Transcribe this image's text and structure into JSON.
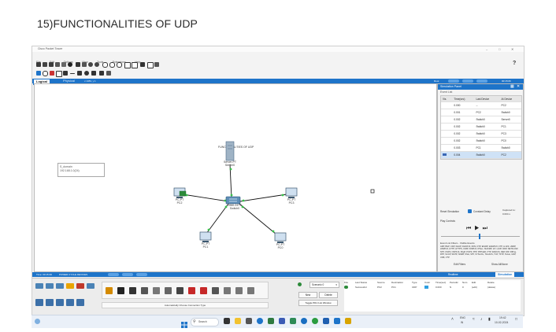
{
  "doc_title": "15)FUNCTIONALITIES  OF UDP",
  "app_title": "Cisco Packet Tracer",
  "menu": [
    "File",
    "Edit",
    "Options",
    "View",
    "Tools",
    "Extensions",
    "Help"
  ],
  "mode_bar": {
    "logical_tab": "Logical",
    "physical_tab": "Physical",
    "coords": "x:1089, y:1",
    "right_items": [
      "Root",
      "",
      "",
      "",
      "",
      "00:15:06"
    ]
  },
  "workspace": {
    "label": "FUNCTIONALITIES OF UDP",
    "note_lines": [
      "S_domain",
      "192.168.1.0(24)"
    ],
    "devices": [
      {
        "id": "server",
        "label1": "Server-PT",
        "label2": "Server0"
      },
      {
        "id": "switch",
        "label1": "2960-24TT",
        "label2": "Switch0"
      },
      {
        "id": "pc2",
        "label1": "PC-PT",
        "label2": "PC2"
      },
      {
        "id": "pc3",
        "label1": "PC-PT",
        "label2": "PC3"
      },
      {
        "id": "pc1",
        "label1": "PC-PT",
        "label2": "PC1"
      },
      {
        "id": "pc0",
        "label1": "PC-PT",
        "label2": "PC0"
      }
    ]
  },
  "sim_panel": {
    "title": "Simulation Panel",
    "subtitle": "Event List",
    "columns": [
      "Vis.",
      "Time(sec)",
      "Last Device",
      "At Device"
    ],
    "rows": [
      [
        "",
        "0.000",
        "--",
        "PC2"
      ],
      [
        "",
        "0.001",
        "PC2",
        "Switch0"
      ],
      [
        "",
        "0.002",
        "Switch0",
        "Server0"
      ],
      [
        "",
        "0.002",
        "Switch0",
        "PC1"
      ],
      [
        "",
        "0.002",
        "Switch0",
        "PC3"
      ],
      [
        "",
        "0.002",
        "Switch0",
        "PC0"
      ],
      [
        "",
        "0.003",
        "PC1",
        "Switch0"
      ],
      [
        "",
        "0.004",
        "Switch0",
        "PC2"
      ]
    ],
    "reset_label": "Reset Simulation",
    "constant_delay_label": "Constant Delay",
    "captured_label": "Captured to:",
    "captured_value": "0.004 s",
    "play_controls_label": "Play Controls",
    "event_filters_label": "Event List Filters - Visible Events",
    "event_filters_value": "ARP, BGP, CDP, DHCP, DHCPv6, DNS, DTP, EIGRP, EIGRPv6, FTP, H.323, HSRP, HSRPv6, HTTP, HTTPS, ICMP, ICMPv6, IPSec, ISAKMP, IoT, LLDP, NDP, NETFLOW, NTP, OSPF, OSPFv6, PAgP, POP3, PPP, PPPoED, PTP, RADIUS, REP, RIP, RIPng, RTP, SCCP, SMTP, SNMP, SSH, STP, SYSLOG, TACACS, TCP, TFTP, Telnet, UDP, USB, VTP",
    "edit_filters": "Edit Filters",
    "show_all": "Show All/None"
  },
  "status_bar": {
    "time": "Time: 00:15:06",
    "power_cycle": "POWER CYCLE DEVICES",
    "fast_forward": "PLAY CONTROLS",
    "realtime": "Realtime",
    "simulation": "Simulation"
  },
  "pdu_panel": {
    "scenario": "Scenario 0",
    "new_btn": "New",
    "delete_btn": "Delete",
    "toggle_btn": "Toggle PDU List Window",
    "columns": [
      "Fire",
      "Last Status",
      "Source",
      "Destination",
      "Type",
      "Color",
      "Time(sec)",
      "Periodic",
      "Num",
      "Edit",
      "Delete"
    ],
    "row": [
      "",
      "Successful",
      "PC2",
      "PC1",
      "UDP",
      "",
      "0.000",
      "N",
      "0",
      "(edit)",
      "(delete)"
    ]
  },
  "connection_label": "Automatically Choose Connection Type",
  "taskbar": {
    "search": "Search",
    "lang1": "ENG",
    "lang2": "IN",
    "time": "19:42",
    "date": "10-02-2024"
  },
  "colors": {
    "accent_blue": "#1e74c9",
    "sim_blue": "#2f7fd6",
    "cable_green": "#2c8a3a",
    "link_dot": "#37c44a"
  }
}
